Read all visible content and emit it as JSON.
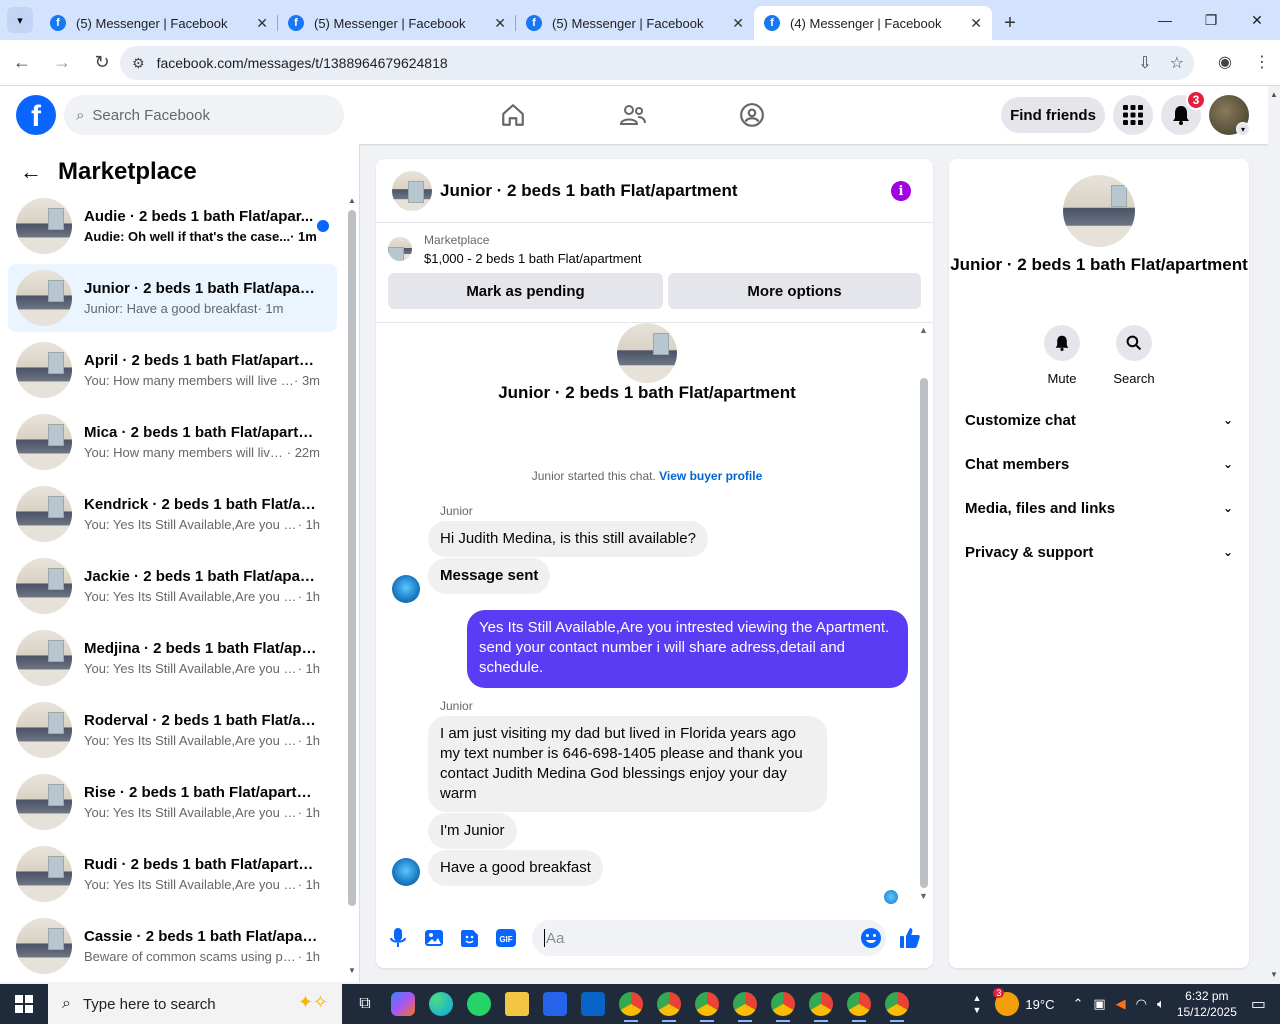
{
  "browser": {
    "tabs": [
      {
        "title": "(5) Messenger | Facebook",
        "active": false
      },
      {
        "title": "(5) Messenger | Facebook",
        "active": false
      },
      {
        "title": "(5) Messenger | Facebook",
        "active": false
      },
      {
        "title": "(4) Messenger | Facebook",
        "active": true
      }
    ],
    "url": "facebook.com/messages/t/1388964679624818"
  },
  "fb": {
    "search_placeholder": "Search Facebook",
    "find_friends": "Find friends",
    "notif_count": "3"
  },
  "left": {
    "title": "Marketplace",
    "conversations": [
      {
        "name": "Audie · 2 beds 1 bath Flat/apar...",
        "snippet": "Audie: Oh well if that's the case...",
        "time": " · 1m",
        "unread": true,
        "selected": false
      },
      {
        "name": "Junior · 2 beds 1 bath Flat/apart...",
        "snippet": "Junior: Have a good breakfast",
        "time": " · 1m",
        "unread": false,
        "selected": true
      },
      {
        "name": "April · 2 beds 1 bath Flat/apartm...",
        "snippet": "You: How many members will live i...",
        "time": " · 3m",
        "unread": false,
        "selected": false
      },
      {
        "name": "Mica · 2 beds 1 bath Flat/apartm...",
        "snippet": "You: How many members will live...",
        "time": " · 22m",
        "unread": false,
        "selected": false
      },
      {
        "name": "Kendrick · 2 beds 1 bath Flat/apa...",
        "snippet": "You: Yes Its Still Available,Are you in...",
        "time": " · 1h",
        "unread": false,
        "selected": false
      },
      {
        "name": "Jackie · 2 beds 1 bath Flat/apart...",
        "snippet": "You: Yes Its Still Available,Are you in...",
        "time": " · 1h",
        "unread": false,
        "selected": false
      },
      {
        "name": "Medjina · 2 beds 1 bath Flat/apa...",
        "snippet": "You: Yes Its Still Available,Are you in...",
        "time": " · 1h",
        "unread": false,
        "selected": false
      },
      {
        "name": "Roderval · 2 beds 1 bath Flat/ap...",
        "snippet": "You: Yes Its Still Available,Are you in...",
        "time": " · 1h",
        "unread": false,
        "selected": false
      },
      {
        "name": "Rise · 2 beds 1 bath Flat/apartm...",
        "snippet": "You: Yes Its Still Available,Are you in...",
        "time": " · 1h",
        "unread": false,
        "selected": false
      },
      {
        "name": "Rudi · 2 beds 1 bath Flat/apartm...",
        "snippet": "You: Yes Its Still Available,Are you in...",
        "time": " · 1h",
        "unread": false,
        "selected": false
      },
      {
        "name": "Cassie · 2 beds 1 bath Flat/apart...",
        "snippet": "Beware of common scams using pa...",
        "time": " · 1h",
        "unread": false,
        "selected": false
      }
    ]
  },
  "chat": {
    "header_title": "Junior · 2 beds 1 bath Flat/apartment",
    "marketplace_label": "Marketplace",
    "listing": "$1,000 - 2 beds 1 bath Flat/apartment",
    "mark_pending": "Mark as pending",
    "more_options": "More options",
    "intro_name": "Junior · 2 beds 1 bath Flat/apartment",
    "started_text": "Junior started this chat.",
    "view_buyer": "View buyer profile",
    "sender1": "Junior",
    "msg1": "Hi Judith Medina, is this still available?",
    "msg2": "Message sent",
    "msg_out": "Yes Its Still Available,Are you intrested viewing the Apartment. send your contact number i will share adress,detail and schedule.",
    "sender2": "Junior",
    "msg3": "I am just visiting my dad but lived in Florida years ago my text number is 646-698-1405  please and thank you contact Judith Medina God blessings enjoy your day warm",
    "msg4": "I'm Junior",
    "msg5": "Have a good breakfast",
    "composer_placeholder": "Aa"
  },
  "right": {
    "name": "Junior · 2 beds 1 bath Flat/apartment",
    "mute": "Mute",
    "search": "Search",
    "sections": [
      "Customize chat",
      "Chat members",
      "Media, files and links",
      "Privacy & support"
    ]
  },
  "taskbar": {
    "search": "Type here to search",
    "weather_badge": "3",
    "temp": "19°C",
    "time": "6:32 pm",
    "date": "15/12/2025"
  },
  "colors": {
    "fb_blue": "#0866ff",
    "outgoing_bubble": "#5b3cf5",
    "info_purple": "#a100e0",
    "notif_red": "#e41e3f"
  }
}
